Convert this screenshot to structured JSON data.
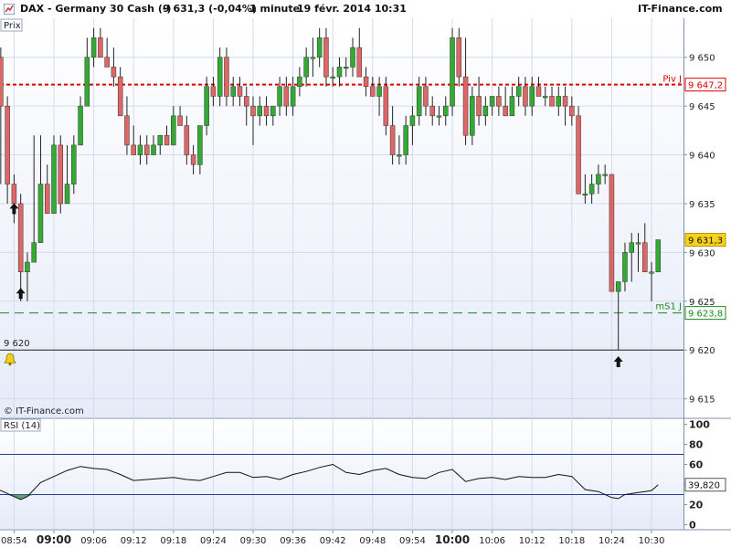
{
  "header": {
    "symbol": "DAX - Germany 30 Cash (-)",
    "quote": "9 631,3 (-0,04%)",
    "interval": "1 minute",
    "datetime": "19 févr. 2014 10:31",
    "brand": "IT-Finance.com"
  },
  "colors": {
    "up": "#33aa33",
    "down": "#dd6666",
    "pivot": "#e00000",
    "support": "#1a8a1a",
    "plot_bg_top": "#ffffff",
    "plot_bg_bottom": "#e6ebf8",
    "rsi_line": "#111111",
    "rsi_band": "#2a3a9a"
  },
  "chart_data": [
    {
      "type": "candlestick",
      "panel_label": "Prix",
      "copyright": "© IT-Finance.com",
      "ylim": [
        9613,
        9654
      ],
      "y_ticks": [
        "9 650",
        "9 645",
        "9 640",
        "9 635",
        "9 630",
        "9 625",
        "9 620",
        "9 615"
      ],
      "y_tick_values": [
        9650,
        9645,
        9640,
        9635,
        9630,
        9625,
        9620,
        9615
      ],
      "x_labels": [
        "08:54",
        "09:00",
        "09:06",
        "09:12",
        "09:18",
        "09:24",
        "09:30",
        "09:36",
        "09:42",
        "09:48",
        "09:54",
        "10:00",
        "10:06",
        "10:12",
        "10:18",
        "10:24",
        "10:30"
      ],
      "x_label_bold": [
        "09:00",
        "10:00"
      ],
      "x_label_minutes": [
        -6,
        0,
        6,
        12,
        18,
        24,
        30,
        36,
        42,
        48,
        54,
        60,
        66,
        72,
        78,
        84,
        90
      ],
      "candles": [
        {
          "m": -9,
          "o": 9650,
          "h": 9651,
          "l": 9647,
          "c": 9651
        },
        {
          "m": -8,
          "o": 9650,
          "h": 9651,
          "l": 9637,
          "c": 9645
        },
        {
          "m": -7,
          "o": 9645,
          "h": 9646,
          "l": 9635,
          "c": 9637
        },
        {
          "m": -6,
          "o": 9637,
          "h": 9638,
          "l": 9633,
          "c": 9635
        },
        {
          "m": -5,
          "o": 9635,
          "h": 9636,
          "l": 9625,
          "c": 9628
        },
        {
          "m": -4,
          "o": 9628,
          "h": 9630,
          "l": 9625,
          "c": 9629
        },
        {
          "m": -3,
          "o": 9629,
          "h": 9642,
          "l": 9629,
          "c": 9631
        },
        {
          "m": -2,
          "o": 9631,
          "h": 9642,
          "l": 9631,
          "c": 9637
        },
        {
          "m": -1,
          "o": 9637,
          "h": 9639,
          "l": 9635,
          "c": 9634
        },
        {
          "m": 0,
          "o": 9634,
          "h": 9642,
          "l": 9634,
          "c": 9641
        },
        {
          "m": 1,
          "o": 9641,
          "h": 9642,
          "l": 9634,
          "c": 9635
        },
        {
          "m": 2,
          "o": 9635,
          "h": 9641,
          "l": 9635,
          "c": 9637
        },
        {
          "m": 3,
          "o": 9637,
          "h": 9642,
          "l": 9636,
          "c": 9641
        },
        {
          "m": 4,
          "o": 9641,
          "h": 9646,
          "l": 9641,
          "c": 9645
        },
        {
          "m": 5,
          "o": 9645,
          "h": 9652,
          "l": 9645,
          "c": 9650
        },
        {
          "m": 6,
          "o": 9650,
          "h": 9653,
          "l": 9649,
          "c": 9652
        },
        {
          "m": 7,
          "o": 9652,
          "h": 9653,
          "l": 9650,
          "c": 9650
        },
        {
          "m": 8,
          "o": 9650,
          "h": 9652,
          "l": 9649,
          "c": 9649
        },
        {
          "m": 9,
          "o": 9649,
          "h": 9651,
          "l": 9647,
          "c": 9648
        },
        {
          "m": 10,
          "o": 9648,
          "h": 9649,
          "l": 9644,
          "c": 9644
        },
        {
          "m": 11,
          "o": 9644,
          "h": 9646,
          "l": 9640,
          "c": 9641
        },
        {
          "m": 12,
          "o": 9641,
          "h": 9643,
          "l": 9640,
          "c": 9640
        },
        {
          "m": 13,
          "o": 9640,
          "h": 9642,
          "l": 9639,
          "c": 9641
        },
        {
          "m": 14,
          "o": 9641,
          "h": 9642,
          "l": 9639,
          "c": 9640
        },
        {
          "m": 15,
          "o": 9640,
          "h": 9642,
          "l": 9640,
          "c": 9641
        },
        {
          "m": 16,
          "o": 9641,
          "h": 9642,
          "l": 9640,
          "c": 9642
        },
        {
          "m": 17,
          "o": 9642,
          "h": 9643,
          "l": 9641,
          "c": 9641
        },
        {
          "m": 18,
          "o": 9641,
          "h": 9645,
          "l": 9641,
          "c": 9644
        },
        {
          "m": 19,
          "o": 9644,
          "h": 9645,
          "l": 9643,
          "c": 9643
        },
        {
          "m": 20,
          "o": 9643,
          "h": 9644,
          "l": 9639,
          "c": 9640
        },
        {
          "m": 21,
          "o": 9640,
          "h": 9641,
          "l": 9638,
          "c": 9639
        },
        {
          "m": 22,
          "o": 9639,
          "h": 9643,
          "l": 9638,
          "c": 9643
        },
        {
          "m": 23,
          "o": 9643,
          "h": 9648,
          "l": 9642,
          "c": 9647
        },
        {
          "m": 24,
          "o": 9647,
          "h": 9648,
          "l": 9645,
          "c": 9646
        },
        {
          "m": 25,
          "o": 9646,
          "h": 9651,
          "l": 9645,
          "c": 9650
        },
        {
          "m": 26,
          "o": 9650,
          "h": 9651,
          "l": 9645,
          "c": 9646
        },
        {
          "m": 27,
          "o": 9646,
          "h": 9648,
          "l": 9645,
          "c": 9647
        },
        {
          "m": 28,
          "o": 9647,
          "h": 9648,
          "l": 9645,
          "c": 9646
        },
        {
          "m": 29,
          "o": 9646,
          "h": 9647,
          "l": 9643,
          "c": 9645
        },
        {
          "m": 30,
          "o": 9645,
          "h": 9646,
          "l": 9641,
          "c": 9644
        },
        {
          "m": 31,
          "o": 9644,
          "h": 9646,
          "l": 9643,
          "c": 9645
        },
        {
          "m": 32,
          "o": 9645,
          "h": 9646,
          "l": 9643,
          "c": 9644
        },
        {
          "m": 33,
          "o": 9644,
          "h": 9645,
          "l": 9643,
          "c": 9645
        },
        {
          "m": 34,
          "o": 9645,
          "h": 9648,
          "l": 9644,
          "c": 9647
        },
        {
          "m": 35,
          "o": 9647,
          "h": 9648,
          "l": 9644,
          "c": 9645
        },
        {
          "m": 36,
          "o": 9645,
          "h": 9648,
          "l": 9644,
          "c": 9647
        },
        {
          "m": 37,
          "o": 9647,
          "h": 9649,
          "l": 9646,
          "c": 9648
        },
        {
          "m": 38,
          "o": 9648,
          "h": 9651,
          "l": 9647,
          "c": 9650
        },
        {
          "m": 39,
          "o": 9650,
          "h": 9652,
          "l": 9648,
          "c": 9650
        },
        {
          "m": 40,
          "o": 9650,
          "h": 9653,
          "l": 9649,
          "c": 9652
        },
        {
          "m": 41,
          "o": 9652,
          "h": 9653,
          "l": 9647,
          "c": 9648
        },
        {
          "m": 42,
          "o": 9648,
          "h": 9649,
          "l": 9647,
          "c": 9648
        },
        {
          "m": 43,
          "o": 9648,
          "h": 9650,
          "l": 9647,
          "c": 9649
        },
        {
          "m": 44,
          "o": 9649,
          "h": 9650,
          "l": 9648,
          "c": 9649
        },
        {
          "m": 45,
          "o": 9649,
          "h": 9652,
          "l": 9648,
          "c": 9651
        },
        {
          "m": 46,
          "o": 9651,
          "h": 9653,
          "l": 9648,
          "c": 9648
        },
        {
          "m": 47,
          "o": 9648,
          "h": 9649,
          "l": 9646,
          "c": 9647
        },
        {
          "m": 48,
          "o": 9647,
          "h": 9648,
          "l": 9646,
          "c": 9646
        },
        {
          "m": 49,
          "o": 9646,
          "h": 9648,
          "l": 9644,
          "c": 9647
        },
        {
          "m": 50,
          "o": 9647,
          "h": 9648,
          "l": 9642,
          "c": 9643
        },
        {
          "m": 51,
          "o": 9643,
          "h": 9645,
          "l": 9639,
          "c": 9640
        },
        {
          "m": 52,
          "o": 9640,
          "h": 9642,
          "l": 9639,
          "c": 9640
        },
        {
          "m": 53,
          "o": 9640,
          "h": 9644,
          "l": 9639,
          "c": 9643
        },
        {
          "m": 54,
          "o": 9643,
          "h": 9645,
          "l": 9641,
          "c": 9644
        },
        {
          "m": 55,
          "o": 9644,
          "h": 9648,
          "l": 9643,
          "c": 9647
        },
        {
          "m": 56,
          "o": 9647,
          "h": 9648,
          "l": 9644,
          "c": 9645
        },
        {
          "m": 57,
          "o": 9645,
          "h": 9646,
          "l": 9643,
          "c": 9644
        },
        {
          "m": 58,
          "o": 9644,
          "h": 9645,
          "l": 9643,
          "c": 9644
        },
        {
          "m": 59,
          "o": 9644,
          "h": 9646,
          "l": 9643,
          "c": 9645
        },
        {
          "m": 60,
          "o": 9645,
          "h": 9653,
          "l": 9644,
          "c": 9652
        },
        {
          "m": 61,
          "o": 9652,
          "h": 9653,
          "l": 9647,
          "c": 9648
        },
        {
          "m": 62,
          "o": 9648,
          "h": 9652,
          "l": 9641,
          "c": 9642
        },
        {
          "m": 63,
          "o": 9642,
          "h": 9647,
          "l": 9641,
          "c": 9646
        },
        {
          "m": 64,
          "o": 9646,
          "h": 9648,
          "l": 9643,
          "c": 9644
        },
        {
          "m": 65,
          "o": 9644,
          "h": 9646,
          "l": 9643,
          "c": 9645
        },
        {
          "m": 66,
          "o": 9645,
          "h": 9646,
          "l": 9644,
          "c": 9646
        },
        {
          "m": 67,
          "o": 9646,
          "h": 9647,
          "l": 9644,
          "c": 9645
        },
        {
          "m": 68,
          "o": 9645,
          "h": 9647,
          "l": 9644,
          "c": 9644
        },
        {
          "m": 69,
          "o": 9644,
          "h": 9647,
          "l": 9644,
          "c": 9646
        },
        {
          "m": 70,
          "o": 9646,
          "h": 9648,
          "l": 9645,
          "c": 9647
        },
        {
          "m": 71,
          "o": 9647,
          "h": 9648,
          "l": 9644,
          "c": 9645
        },
        {
          "m": 72,
          "o": 9645,
          "h": 9648,
          "l": 9644,
          "c": 9647
        },
        {
          "m": 73,
          "o": 9647,
          "h": 9648,
          "l": 9646,
          "c": 9646
        },
        {
          "m": 74,
          "o": 9646,
          "h": 9647,
          "l": 9645,
          "c": 9646
        },
        {
          "m": 75,
          "o": 9646,
          "h": 9647,
          "l": 9645,
          "c": 9645
        },
        {
          "m": 76,
          "o": 9645,
          "h": 9647,
          "l": 9644,
          "c": 9646
        },
        {
          "m": 77,
          "o": 9646,
          "h": 9647,
          "l": 9643,
          "c": 9645
        },
        {
          "m": 78,
          "o": 9645,
          "h": 9646,
          "l": 9643,
          "c": 9644
        },
        {
          "m": 79,
          "o": 9644,
          "h": 9645,
          "l": 9636,
          "c": 9636
        },
        {
          "m": 80,
          "o": 9636,
          "h": 9638,
          "l": 9635,
          "c": 9636
        },
        {
          "m": 81,
          "o": 9636,
          "h": 9638,
          "l": 9635,
          "c": 9637
        },
        {
          "m": 82,
          "o": 9637,
          "h": 9639,
          "l": 9636,
          "c": 9638
        },
        {
          "m": 83,
          "o": 9638,
          "h": 9639,
          "l": 9637,
          "c": 9638
        },
        {
          "m": 84,
          "o": 9638,
          "h": 9638,
          "l": 9626,
          "c": 9626
        },
        {
          "m": 85,
          "o": 9626,
          "h": 9627,
          "l": 9620,
          "c": 9627
        },
        {
          "m": 86,
          "o": 9627,
          "h": 9631,
          "l": 9626,
          "c": 9630
        },
        {
          "m": 87,
          "o": 9630,
          "h": 9632,
          "l": 9627,
          "c": 9631
        },
        {
          "m": 88,
          "o": 9631,
          "h": 9632,
          "l": 9628,
          "c": 9631
        },
        {
          "m": 89,
          "o": 9631,
          "h": 9633,
          "l": 9628,
          "c": 9628
        },
        {
          "m": 90,
          "o": 9628,
          "h": 9629,
          "l": 9625,
          "c": 9628
        },
        {
          "m": 91,
          "o": 9628,
          "h": 9631.3,
          "l": 9628,
          "c": 9631.3
        }
      ],
      "pivot": {
        "label": "Piv J",
        "value": 9647.2,
        "value_text": "9 647,2"
      },
      "support": {
        "label": "mS1 J",
        "value": 9623.8,
        "value_text": "9 623,8"
      },
      "last_price": {
        "value": 9631.3,
        "value_text": "9 631,3"
      },
      "alert": {
        "label": "9 620",
        "value": 9620
      },
      "arrows_up": [
        {
          "m": -6,
          "price": 9634.5
        },
        {
          "m": -5,
          "price": 9625.8
        },
        {
          "m": 85,
          "price": 9618.8
        }
      ]
    },
    {
      "type": "line",
      "panel_label": "RSI (14)",
      "ylim": [
        -5,
        105
      ],
      "y_ticks": [
        "100",
        "80",
        "60",
        "40",
        "20",
        "0"
      ],
      "y_tick_values": [
        100,
        80,
        60,
        40,
        20,
        0
      ],
      "bands": [
        70,
        30
      ],
      "last_value_text": "39,820",
      "x_minutes": [
        -10,
        -8,
        -6,
        -5,
        -4,
        -2,
        0,
        2,
        4,
        6,
        8,
        10,
        12,
        14,
        16,
        18,
        20,
        22,
        24,
        26,
        28,
        30,
        32,
        34,
        36,
        38,
        40,
        42,
        44,
        46,
        48,
        50,
        52,
        54,
        56,
        58,
        60,
        62,
        64,
        66,
        68,
        70,
        72,
        74,
        76,
        78,
        80,
        82,
        84,
        85,
        86,
        88,
        90,
        91
      ],
      "values": [
        38,
        34,
        28,
        25,
        28,
        42,
        48,
        54,
        58,
        56,
        55,
        50,
        44,
        45,
        46,
        47,
        45,
        44,
        48,
        52,
        52,
        47,
        48,
        45,
        50,
        53,
        57,
        60,
        52,
        50,
        54,
        56,
        50,
        47,
        46,
        52,
        55,
        43,
        46,
        47,
        45,
        48,
        47,
        47,
        50,
        48,
        35,
        33,
        27,
        26,
        30,
        32,
        34,
        39.8
      ]
    }
  ]
}
